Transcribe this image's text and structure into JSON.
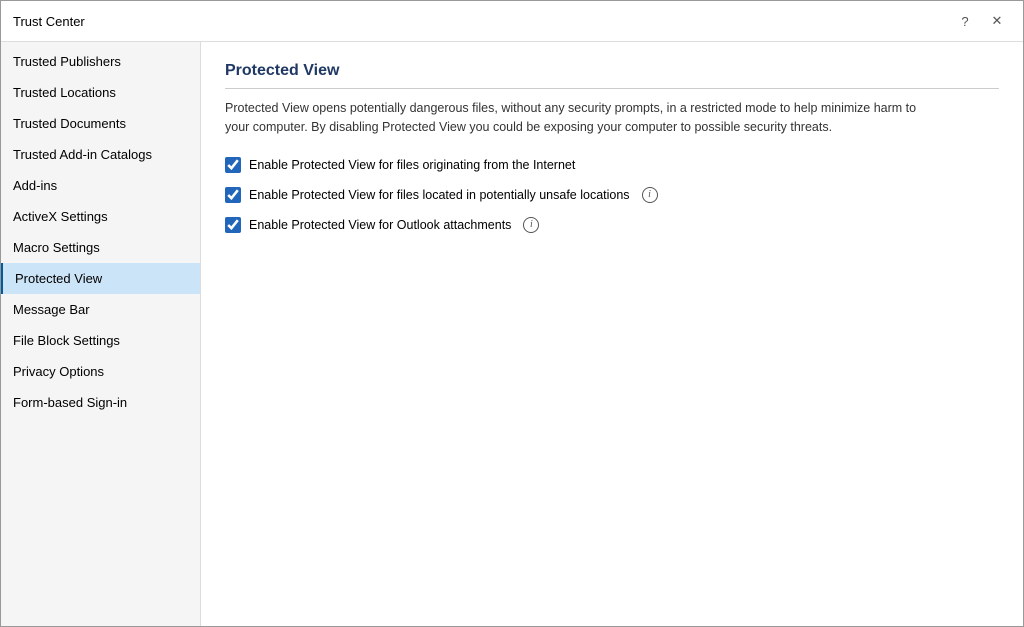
{
  "dialog": {
    "title": "Trust Center"
  },
  "titlebar": {
    "help_label": "?",
    "close_label": "✕"
  },
  "sidebar": {
    "items": [
      {
        "id": "trusted-publishers",
        "label": "Trusted Publishers",
        "active": false
      },
      {
        "id": "trusted-locations",
        "label": "Trusted Locations",
        "active": false
      },
      {
        "id": "trusted-documents",
        "label": "Trusted Documents",
        "active": false
      },
      {
        "id": "trusted-add-in-catalogs",
        "label": "Trusted Add-in Catalogs",
        "active": false
      },
      {
        "id": "add-ins",
        "label": "Add-ins",
        "active": false
      },
      {
        "id": "activex-settings",
        "label": "ActiveX Settings",
        "active": false
      },
      {
        "id": "macro-settings",
        "label": "Macro Settings",
        "active": false
      },
      {
        "id": "protected-view",
        "label": "Protected View",
        "active": true
      },
      {
        "id": "message-bar",
        "label": "Message Bar",
        "active": false
      },
      {
        "id": "file-block-settings",
        "label": "File Block Settings",
        "active": false
      },
      {
        "id": "privacy-options",
        "label": "Privacy Options",
        "active": false
      },
      {
        "id": "form-based-sign-in",
        "label": "Form-based Sign-in",
        "active": false
      }
    ]
  },
  "main": {
    "section_title": "Protected View",
    "description": "Protected View opens potentially dangerous files, without any security prompts, in a restricted mode to help minimize harm to your computer. By disabling Protected View you could be exposing your computer to possible security threats.",
    "checkboxes": [
      {
        "id": "cb-internet",
        "label": "Enable Protected View for files originating from the Internet",
        "checked": true,
        "has_info": false
      },
      {
        "id": "cb-unsafe-locations",
        "label": "Enable Protected View for files located in potentially unsafe locations",
        "checked": true,
        "has_info": true
      },
      {
        "id": "cb-outlook",
        "label": "Enable Protected View for Outlook attachments",
        "checked": true,
        "has_info": true
      }
    ]
  }
}
